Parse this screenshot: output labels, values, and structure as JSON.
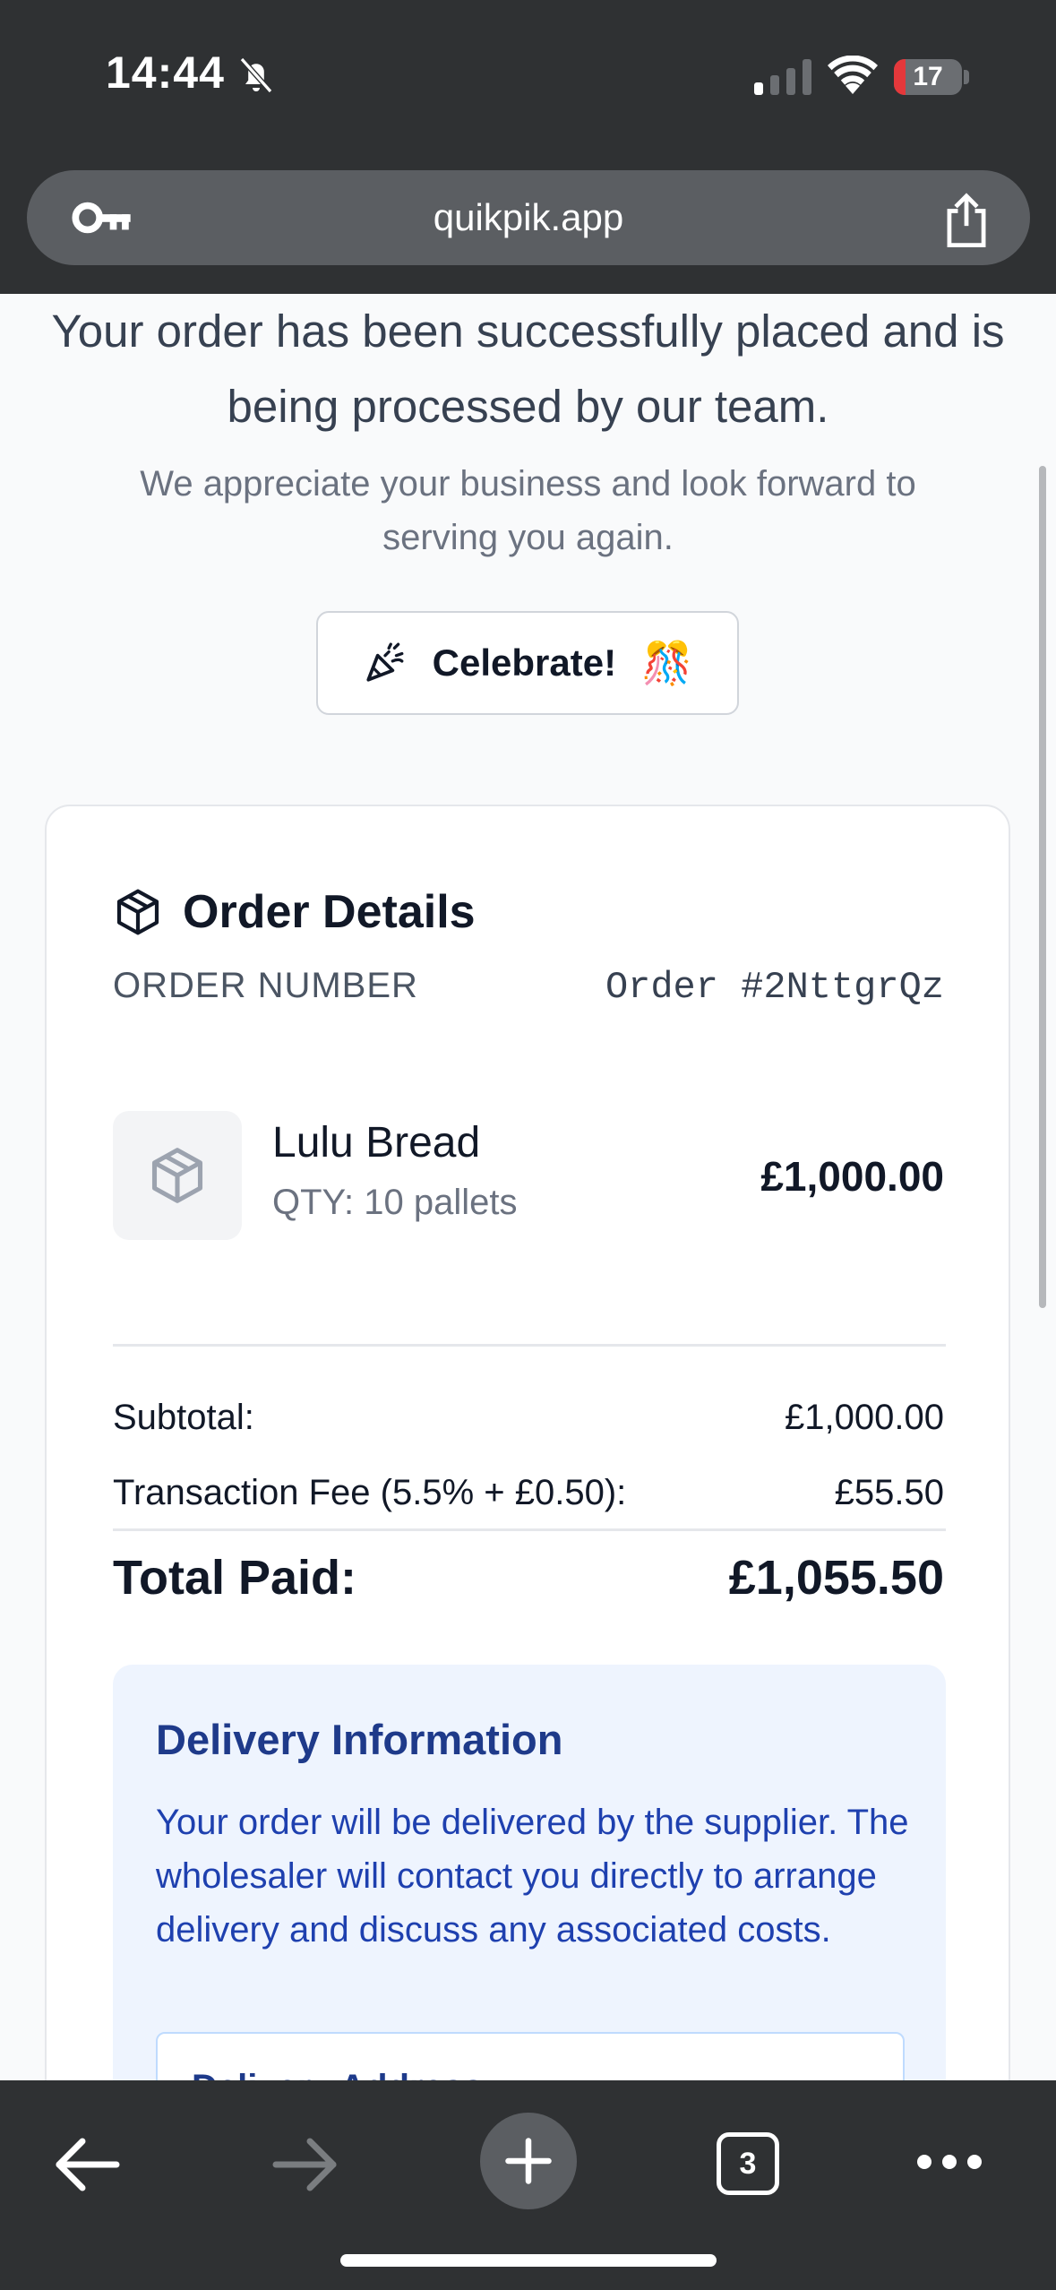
{
  "status_bar": {
    "time": "14:44",
    "battery_level": "17",
    "battery_fraction": 0.17
  },
  "browser": {
    "url": "quikpik.app",
    "tab_count": "3"
  },
  "page": {
    "headline": "Your order has been successfully placed and is being processed by our team.",
    "subline": "We appreciate your business and look forward to serving you again.",
    "celebrate_label": "Celebrate!",
    "celebrate_emoji": "🎊"
  },
  "order": {
    "title": "Order Details",
    "number_label": "ORDER NUMBER",
    "number_value": "Order #2NttgrQz",
    "item": {
      "name": "Lulu Bread",
      "qty": "QTY: 10 pallets",
      "price": "£1,000.00"
    },
    "subtotal_label": "Subtotal:",
    "subtotal_value": "£1,000.00",
    "fee_label": "Transaction Fee (5.5% + £0.50):",
    "fee_value": "£55.50",
    "total_label": "Total Paid:",
    "total_value": "£1,055.50"
  },
  "delivery": {
    "title": "Delivery Information",
    "text": "Your order will be delivered by the supplier. The wholesaler will contact you directly to arrange delivery and discuss any associated costs.",
    "address_title": "Delivery Address:"
  },
  "colors": {
    "accent_blue": "#1e40af",
    "box_bg": "#eef4fe",
    "battery_red": "#e5383b"
  }
}
